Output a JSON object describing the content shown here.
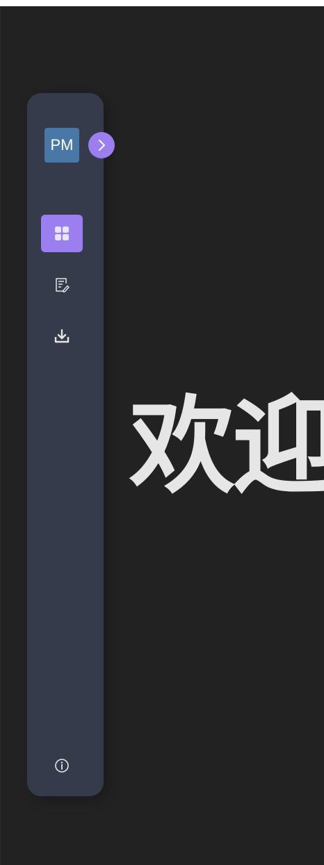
{
  "sidebar": {
    "avatar_initials": "PM",
    "expand_icon": "chevron-right-icon",
    "nav_items": [
      {
        "id": "dashboard",
        "icon": "grid-icon",
        "active": true
      },
      {
        "id": "editor",
        "icon": "edit-note-icon",
        "active": false
      },
      {
        "id": "download",
        "icon": "download-icon",
        "active": false
      }
    ],
    "footer_icon": "info-icon"
  },
  "main": {
    "welcome_text": "欢迎"
  },
  "colors": {
    "background": "#222222",
    "sidebar": "#353b4a",
    "accent": "#9b7ff0",
    "avatar": "#4a78a6",
    "heading": "#e6e6e6"
  }
}
